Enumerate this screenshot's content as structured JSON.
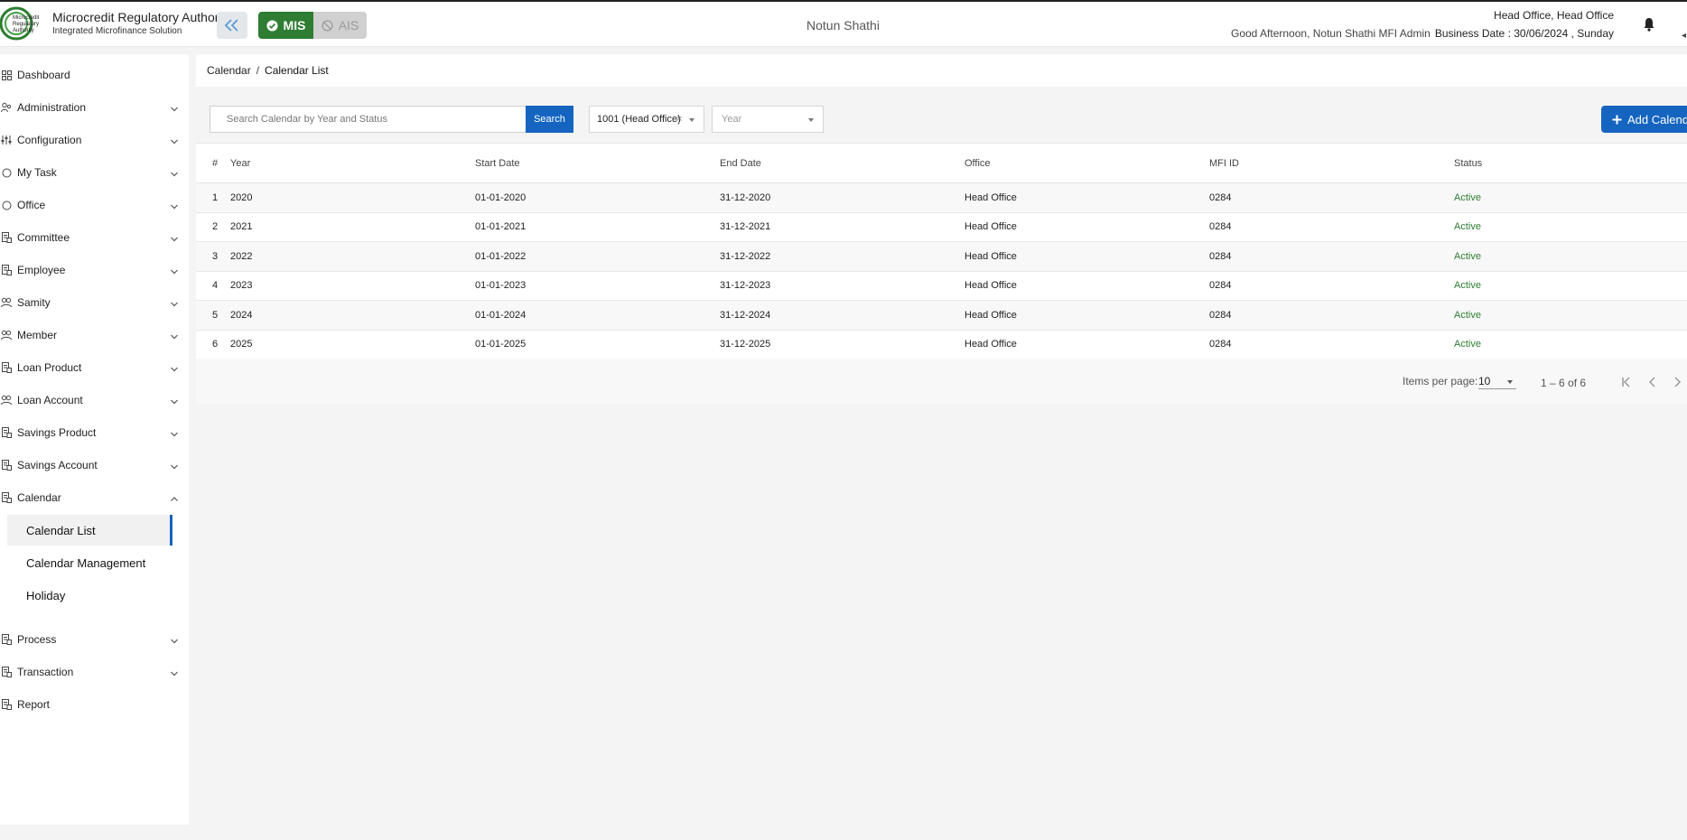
{
  "header": {
    "brand_title": "Microcredit Regulatory Authority",
    "brand_subtitle": "Integrated Microfinance Solution",
    "logo_text": [
      "Microcredit",
      "Regulatory",
      "Authority"
    ],
    "mode_mis": "MIS",
    "mode_ais": "AIS",
    "org_name": "Notun Shathi",
    "greeting": "Good Afternoon, Notun Shathi MFI Admin",
    "office": "Head Office, Head Office",
    "business_date": "Business Date : 30/06/2024 , Sunday"
  },
  "sidebar": {
    "items": [
      {
        "label": "Dashboard",
        "icon": "grid-icon",
        "chevron": "none"
      },
      {
        "label": "Administration",
        "icon": "people-icon",
        "chevron": "down"
      },
      {
        "label": "Configuration",
        "icon": "sliders-icon",
        "chevron": "down"
      },
      {
        "label": "My Task",
        "icon": "circle-icon",
        "chevron": "down"
      },
      {
        "label": "Office",
        "icon": "circle-icon",
        "chevron": "down"
      },
      {
        "label": "Committee",
        "icon": "document-icon",
        "chevron": "down"
      },
      {
        "label": "Employee",
        "icon": "document-icon",
        "chevron": "down"
      },
      {
        "label": "Samity",
        "icon": "group-icon",
        "chevron": "down"
      },
      {
        "label": "Member",
        "icon": "group-icon",
        "chevron": "down"
      },
      {
        "label": "Loan Product",
        "icon": "document-icon",
        "chevron": "down"
      },
      {
        "label": "Loan Account",
        "icon": "group-icon",
        "chevron": "down"
      },
      {
        "label": "Savings Product",
        "icon": "document-icon",
        "chevron": "down"
      },
      {
        "label": "Savings Account",
        "icon": "document-icon",
        "chevron": "down"
      },
      {
        "label": "Calendar",
        "icon": "document-icon",
        "chevron": "up"
      }
    ],
    "calendar_sub": [
      "Calendar List",
      "Calendar Management",
      "Holiday"
    ],
    "bottom_items": [
      {
        "label": "Process",
        "icon": "document-icon",
        "chevron": "down"
      },
      {
        "label": "Transaction",
        "icon": "document-icon",
        "chevron": "down"
      },
      {
        "label": "Report",
        "icon": "document-icon",
        "chevron": "none"
      }
    ]
  },
  "breadcrumb": {
    "parent": "Calendar",
    "separator": "/",
    "current": "Calendar List"
  },
  "toolbar": {
    "search_placeholder": "Search Calendar by Year and Status",
    "search_button": "Search",
    "office_filter": "1001 (Head Office)",
    "office_clear": "×",
    "year_placeholder": "Year",
    "add_button": "Add Calendar"
  },
  "table": {
    "headers": [
      "#",
      "Year",
      "Start Date",
      "End Date",
      "Office",
      "MFI ID",
      "Status"
    ],
    "rows": [
      [
        "1",
        "2020",
        "01-01-2020",
        "31-12-2020",
        "Head Office",
        "0284",
        "Active"
      ],
      [
        "2",
        "2021",
        "01-01-2021",
        "31-12-2021",
        "Head Office",
        "0284",
        "Active"
      ],
      [
        "3",
        "2022",
        "01-01-2022",
        "31-12-2022",
        "Head Office",
        "0284",
        "Active"
      ],
      [
        "4",
        "2023",
        "01-01-2023",
        "31-12-2023",
        "Head Office",
        "0284",
        "Active"
      ],
      [
        "5",
        "2024",
        "01-01-2024",
        "31-12-2024",
        "Head Office",
        "0284",
        "Active"
      ],
      [
        "6",
        "2025",
        "01-01-2025",
        "31-12-2025",
        "Head Office",
        "0284",
        "Active"
      ]
    ]
  },
  "paginator": {
    "items_label": "Items per page:",
    "page_size": "10",
    "range": "1 – 6 of 6"
  },
  "colors": {
    "primary": "#1565c0",
    "mis_green": "#2e7d32",
    "status_green": "#2e7d32"
  }
}
